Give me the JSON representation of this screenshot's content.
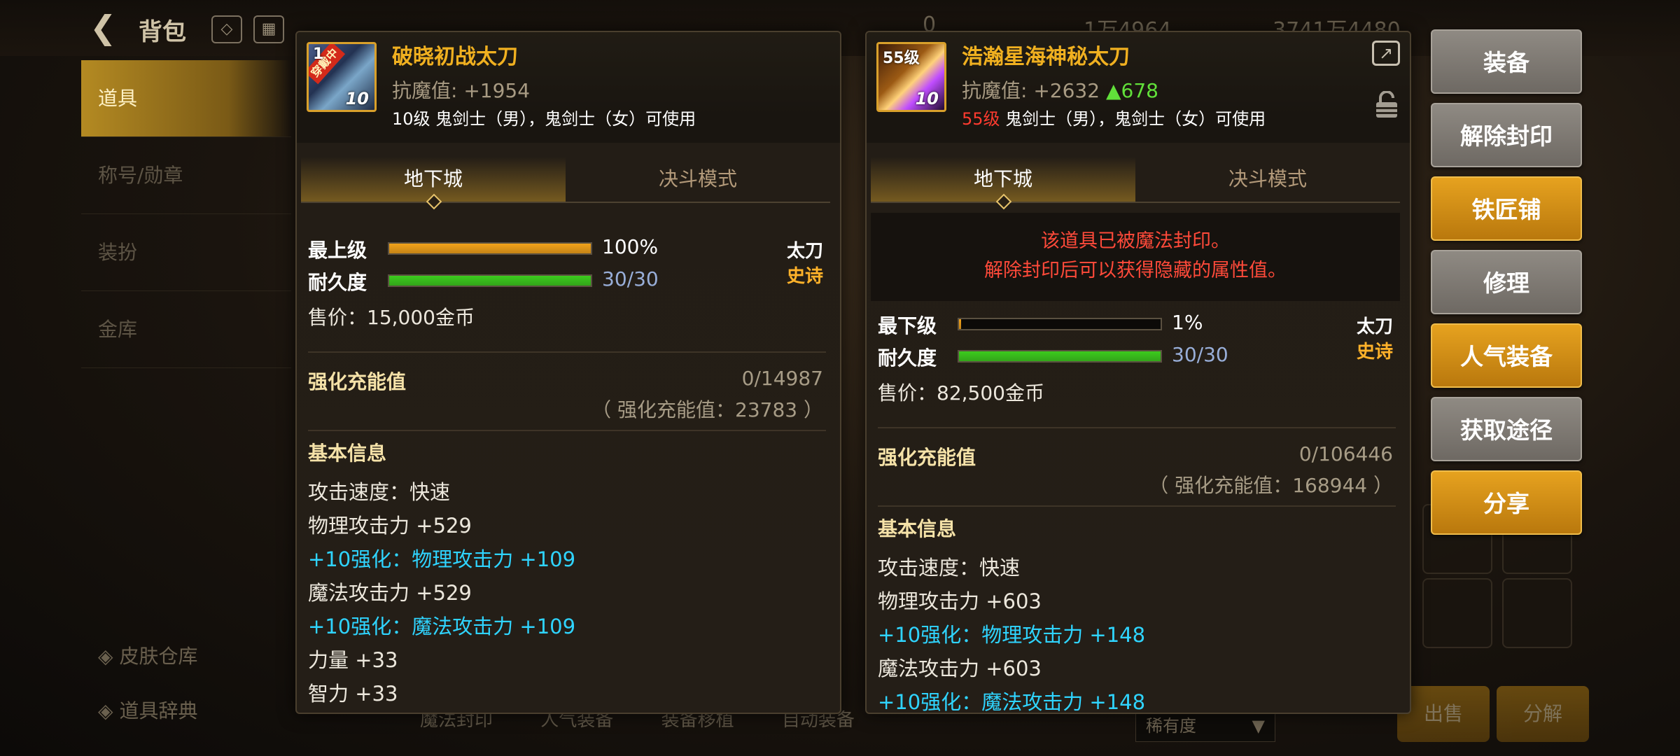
{
  "background": {
    "title": "背包",
    "currency": [
      "0",
      "1万4964",
      "3741万4480"
    ],
    "nav": [
      "道具",
      "称号/勋章",
      "装扮",
      "金库"
    ],
    "side_bottom": [
      "皮肤仓库",
      "道具辞典"
    ],
    "bottom_tabs": [
      "魔法封印",
      "人气装备",
      "装备移植",
      "自动装备"
    ],
    "rarity_dropdown": "稀有度",
    "sell_button": "出售",
    "disassemble_button": "分解"
  },
  "left_item": {
    "level_badge": "1",
    "equipped_badge": "穿戴中",
    "plus": "10",
    "name": "破晓初战太刀",
    "stat_label": "抗魔值:",
    "stat_value": "+1954",
    "usage_level": "10级",
    "usage_text": " 鬼剑士（男），鬼剑士（女）可使用",
    "tab_dungeon": "地下城",
    "tab_duel": "决斗模式",
    "grade_label": "最上级",
    "grade_value": "100%",
    "grade_fraction": 1.0,
    "durability_label": "耐久度",
    "durability_value": "30/30",
    "durability_fraction": 1.0,
    "weapon_type": "太刀",
    "rarity": "史诗",
    "price": "售价：15,000金币",
    "charge_title": "强化充能值",
    "charge_value": "0/14987",
    "charge_total": "（ 强化充能值：23783 ）",
    "basic_title": "基本信息",
    "lines": [
      {
        "text": "攻击速度：快速",
        "cyan": false
      },
      {
        "text": "物理攻击力 +529",
        "cyan": false
      },
      {
        "text": "+10强化：物理攻击力 +109",
        "cyan": true
      },
      {
        "text": "魔法攻击力 +529",
        "cyan": false
      },
      {
        "text": "+10强化：魔法攻击力 +109",
        "cyan": true
      },
      {
        "text": "力量 +33",
        "cyan": false
      },
      {
        "text": "智力 +33",
        "cyan": false
      }
    ]
  },
  "right_item": {
    "level_badge": "55级",
    "plus": "10",
    "name": "浩瀚星海神秘太刀",
    "stat_label": "抗魔值:",
    "stat_value": "+2632",
    "stat_up": "▲678",
    "usage_level": "55级",
    "usage_text": " 鬼剑士（男），鬼剑士（女）可使用",
    "tab_dungeon": "地下城",
    "tab_duel": "决斗模式",
    "seal_line1": "该道具已被魔法封印。",
    "seal_line2": "解除封印后可以获得隐藏的属性值。",
    "grade_label": "最下级",
    "grade_value": "1%",
    "grade_fraction": 0.01,
    "durability_label": "耐久度",
    "durability_value": "30/30",
    "durability_fraction": 1.0,
    "weapon_type": "太刀",
    "rarity": "史诗",
    "price": "售价：82,500金币",
    "charge_title": "强化充能值",
    "charge_value": "0/106446",
    "charge_total": "（ 强化充能值：168944 ）",
    "basic_title": "基本信息",
    "lines": [
      {
        "text": "攻击速度：快速",
        "cyan": false
      },
      {
        "text": "物理攻击力 +603",
        "cyan": false
      },
      {
        "text": "+10强化：物理攻击力 +148",
        "cyan": true
      },
      {
        "text": "魔法攻击力 +603",
        "cyan": false
      },
      {
        "text": "+10强化：魔法攻击力 +148",
        "cyan": true
      }
    ]
  },
  "actions": [
    {
      "label": "装备",
      "style": "gray"
    },
    {
      "label": "解除封印",
      "style": "gray"
    },
    {
      "label": "铁匠铺",
      "style": "gold"
    },
    {
      "label": "修理",
      "style": "gray"
    },
    {
      "label": "人气装备",
      "style": "gold"
    },
    {
      "label": "获取途径",
      "style": "gray"
    },
    {
      "label": "分享",
      "style": "gold"
    }
  ],
  "colors": {
    "gold_accent": "#f0b020",
    "grade_bar": "#f2a21a",
    "durability_bar": "#3ccb1e",
    "seal_text": "#ff4a3a",
    "enhance_text": "#2fd4ff"
  }
}
